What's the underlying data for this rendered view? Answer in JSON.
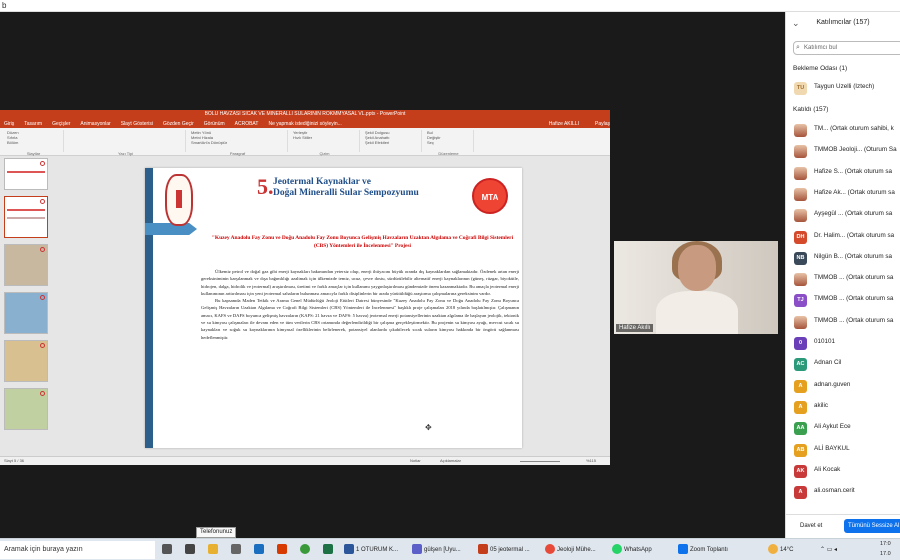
{
  "top_glyph": "b",
  "ppt": {
    "title": "BOLU HAVZASI SICAK VE MINERALLI SULARININ ROKMMYASAL VL.pptx - PowerPoint",
    "tabs": [
      "Giriş",
      "Tasarım",
      "Geçişler",
      "Animasyonlar",
      "Slayt Gösterisi",
      "Gözden Geçir",
      "Görünüm",
      "ACROBAT",
      "Ne yapmak istediğinizi söyleyin..."
    ],
    "user": "Hafize AKILLI",
    "share": "Paylaş",
    "ribbon_lines": [
      "Düzen",
      "Sıfırla",
      "Bölüm",
      "Metin Yönü",
      "Metni Hizala",
      "SmartArt'a Dönüştür",
      "Yerleştir",
      "Hızlı Stiller",
      "Şekil Dolgusu",
      "Şekil Anahattı",
      "Şekil Efektleri",
      "Bul",
      "Değiştir",
      "Seç"
    ],
    "ribbon_groups": [
      "Slaytlar",
      "Yazı Tipi",
      "Paragraf",
      "Çizim",
      "Düzenleme"
    ],
    "slide": {
      "number": "5.",
      "title_line1": "Jeotermal Kaynaklar ve",
      "title_line2": "Doğal Mineralli Sular Sempozyumu",
      "mta_logo": "MTA",
      "project_title": "\"Kuzey Anadolu Fay Zonu ve Doğu Anadolu Fay Zonu Boyunca Gelişmiş Havzaların Uzaktan Algılama ve Coğrafi Bilgi Sistemleri (CBS) Yöntemleri ile İncelenmesi\" Projesi",
      "paragraph1": "Ülkemiz petrol ve doğal gaz gibi enerji kaynakları bakımından yetersiz olup, enerji ihtiyacını büyük oranda dış kaynaklardan sağlamaktadır. Özdenek artan enerji gereksiniminin karşılanmak ve dışa bağımlılığı azaltmak için ülkemizde temiz, ucuz, çevre dostu, sürdürülebilir alternatif enerji kaynaklarının (güneş, rüzgar, biyokütle, hidrojen, dalga, hidrolik ve jeotermal) araştırılması, üretimi ve farklı amaçlar için kullanımı yaygınlaştırılması gündemizde önem kazanmaktadır. Bu amaçla jeotermal enerji kullanımının arttırılması için yeni jeotermal sahaların bulunması amacıyla farklı disiplinlerin bir arada yürütüldüğü araştırma çalışmalarına gereksinim vardır.",
      "paragraph2": "Bu kapsamda Maden Tetkik ve Arama Genel Müdürlüğü Jeoloji Etütleri Dairesi bünyesinde \"Kuzey Anadolu Fay Zonu ve Doğu Anadolu Fay Zonu Boyunca Gelişmiş Havzaların Uzaktan Algılama ve Coğrafi Bilgi Sistemleri (CBS) Yöntemleri ile İncelenmesi\" başlıklı proje çalışmaları 2018 yılında başlatılmıştır. Çalışmanın amacı, KAFS ve DAFS boyunca gelişmiş havzaların (KAFS: 21 havza ve DAFS: 5 havza) jeotermal enerji potansiyellerinin uzaktan algılama ile başlayan jeolojik, tektonik ve su kimyası çalışmaları ile devam eden ve tüm verilerin CBS ortamında değerlendirildiği bir çalışma gerçekleştirmektir. Bu projenin su kimyası ayağı, mevcut sıcak su kaynakları ve soğuk su kaynaklarının kimyasal özelliklerinin belirlenerek, potansiyel alanlarda çıkabilecek sıcak suların kimyası hakkında bir öngörü sağlanması hedeflenmiştir."
    },
    "status_left": "Slayt 5 / 36",
    "status_items": [
      "Notlar",
      "Açıklamalar",
      "%115"
    ]
  },
  "video": {
    "name": "Hafize Akıllı"
  },
  "panel": {
    "title": "Katılımcılar (157)",
    "search_placeholder": "Katılımcı bul",
    "waiting_label": "Bekleme Odası (1)",
    "waiting": [
      {
        "initials": "TU",
        "name": "Taygun Uzelli (Iztech)",
        "color": "#f0d9b0"
      }
    ],
    "joined_label": "Katıldı (157)",
    "participants": [
      {
        "initials": "",
        "name": "TM... (Ortak oturum sahibi, k",
        "color": "photo"
      },
      {
        "initials": "",
        "name": "TMMOB Jeoloji... (Oturum Sa",
        "color": "photo"
      },
      {
        "initials": "",
        "name": "Hafize S... (Ortak oturum sa",
        "color": "photo"
      },
      {
        "initials": "",
        "name": "Hafize Ak... (Ortak oturum sa",
        "color": "photo"
      },
      {
        "initials": "",
        "name": "Ayşegül ... (Ortak oturum sa",
        "color": "photo"
      },
      {
        "initials": "DH",
        "name": "Dr. Halim... (Ortak oturum sa",
        "color": "#d44a2a"
      },
      {
        "initials": "NB",
        "name": "Nilgün B... (Ortak oturum sa",
        "color": "#3a4a5a"
      },
      {
        "initials": "",
        "name": "TMMOB ... (Ortak oturum sa",
        "color": "photo"
      },
      {
        "initials": "TJ",
        "name": "TMMOB ... (Ortak oturum sa",
        "color": "#8a4fc6"
      },
      {
        "initials": "",
        "name": "TMMOB ... (Ortak oturum sa",
        "color": "photo"
      },
      {
        "initials": "0",
        "name": "010101",
        "color": "#6a3fb8"
      },
      {
        "initials": "AC",
        "name": "Adnan Cil",
        "color": "#2a9a7a"
      },
      {
        "initials": "A",
        "name": "adnan.guven",
        "color": "#e6a020"
      },
      {
        "initials": "A",
        "name": "akilic",
        "color": "#e6a020"
      },
      {
        "initials": "AA",
        "name": "Ali Aykut Ece",
        "color": "#3aa050"
      },
      {
        "initials": "AB",
        "name": "ALİ BAYKUL",
        "color": "#e6a020"
      },
      {
        "initials": "AK",
        "name": "Ali Kocak",
        "color": "#c83a3a"
      },
      {
        "initials": "A",
        "name": "ali.osman.cerit",
        "color": "#c83a3a"
      }
    ],
    "invite_button": "Davet et",
    "mute_all_button": "Tümünü Sessize Al"
  },
  "taskbar": {
    "search": "Aramak için buraya yazın",
    "tooltip": "Telefonunuz",
    "apps": [
      "1 OTURUM K...",
      "gülşen [Uyu...",
      "05 jeotermal ...",
      "Jeoloji Mühe...",
      "WhatsApp",
      "Zoom Toplantı"
    ],
    "weather": "14°C",
    "time": "17:0",
    "date": "17.0"
  }
}
